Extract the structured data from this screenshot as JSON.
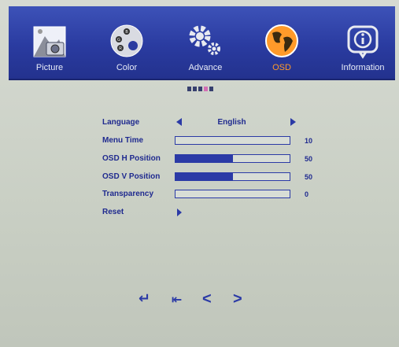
{
  "tabs": [
    {
      "label": "Picture",
      "icon": "picture-icon",
      "active": false
    },
    {
      "label": "Color",
      "icon": "color-palette-icon",
      "active": false
    },
    {
      "label": "Advance",
      "icon": "gear-icon",
      "active": false
    },
    {
      "label": "OSD",
      "icon": "globe-icon",
      "active": true
    },
    {
      "label": "Information",
      "icon": "info-icon",
      "active": false
    }
  ],
  "menu": {
    "language": {
      "label": "Language",
      "value": "English"
    },
    "menu_time": {
      "label": "Menu Time",
      "value": "10"
    },
    "osd_h": {
      "label": "OSD H Position",
      "value": "50"
    },
    "osd_v": {
      "label": "OSD V Position",
      "value": "50"
    },
    "transparency": {
      "label": "Transparency",
      "value": "0"
    },
    "reset": {
      "label": "Reset"
    }
  },
  "levels": {
    "menu_time": 0.0,
    "osd_h": 0.5,
    "osd_v": 0.5,
    "transparency": 0.0
  },
  "nav": {
    "enter": "↵",
    "exit": "⇤",
    "left": "<",
    "right": ">"
  },
  "colors": {
    "accent": "#2b3aa6",
    "active": "#ff9a2a",
    "banner": "#2a3ba0"
  }
}
